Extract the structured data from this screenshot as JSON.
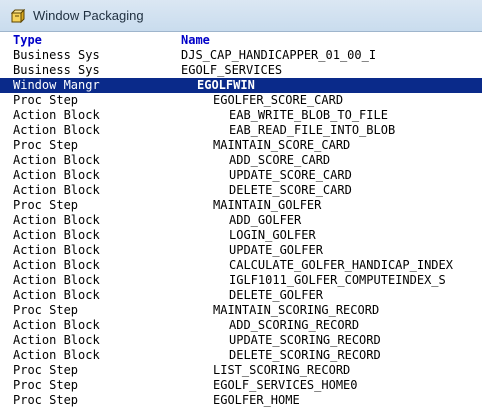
{
  "window": {
    "title": "Window Packaging",
    "icon": "package-icon"
  },
  "table": {
    "header": {
      "type": "Type",
      "name": "Name"
    },
    "rows": [
      {
        "type": "Business Sys",
        "name": "DJS_CAP_HANDICAPPER_01_00_I",
        "level": 0
      },
      {
        "type": "Business Sys",
        "name": "EGOLF_SERVICES",
        "level": 0
      },
      {
        "type": "Window Mangr",
        "name": "EGOLFWIN",
        "level": 1,
        "selected": true
      },
      {
        "type": "Proc Step",
        "name": "EGOLFER_SCORE_CARD",
        "level": 2
      },
      {
        "type": "Action Block",
        "name": "EAB_WRITE_BLOB_TO_FILE",
        "level": 3
      },
      {
        "type": "Action Block",
        "name": "EAB_READ_FILE_INTO_BLOB",
        "level": 3
      },
      {
        "type": "Proc Step",
        "name": "MAINTAIN_SCORE_CARD",
        "level": 2
      },
      {
        "type": "Action Block",
        "name": "ADD_SCORE_CARD",
        "level": 3
      },
      {
        "type": "Action Block",
        "name": "UPDATE_SCORE_CARD",
        "level": 3
      },
      {
        "type": "Action Block",
        "name": "DELETE_SCORE_CARD",
        "level": 3
      },
      {
        "type": "Proc Step",
        "name": "MAINTAIN_GOLFER",
        "level": 2
      },
      {
        "type": "Action Block",
        "name": "ADD_GOLFER",
        "level": 3
      },
      {
        "type": "Action Block",
        "name": "LOGIN_GOLFER",
        "level": 3
      },
      {
        "type": "Action Block",
        "name": "UPDATE_GOLFER",
        "level": 3
      },
      {
        "type": "Action Block",
        "name": "CALCULATE_GOLFER_HANDICAP_INDEX",
        "level": 3
      },
      {
        "type": "Action Block",
        "name": "IGLF1011_GOLFER_COMPUTEINDEX_S",
        "level": 3
      },
      {
        "type": "Action Block",
        "name": "DELETE_GOLFER",
        "level": 3
      },
      {
        "type": "Proc Step",
        "name": "MAINTAIN_SCORING_RECORD",
        "level": 2
      },
      {
        "type": "Action Block",
        "name": "ADD_SCORING_RECORD",
        "level": 3
      },
      {
        "type": "Action Block",
        "name": "UPDATE_SCORING_RECORD",
        "level": 3
      },
      {
        "type": "Action Block",
        "name": "DELETE_SCORING_RECORD",
        "level": 3
      },
      {
        "type": "Proc Step",
        "name": "LIST_SCORING_RECORD",
        "level": 2
      },
      {
        "type": "Proc Step",
        "name": "EGOLF_SERVICES_HOME0",
        "level": 2
      },
      {
        "type": "Proc Step",
        "name": "EGOLFER_HOME",
        "level": 2
      }
    ]
  },
  "colors": {
    "header_text": "#0000c8",
    "selection_bg": "#0a2a8a",
    "selection_text": "#ffffff"
  }
}
